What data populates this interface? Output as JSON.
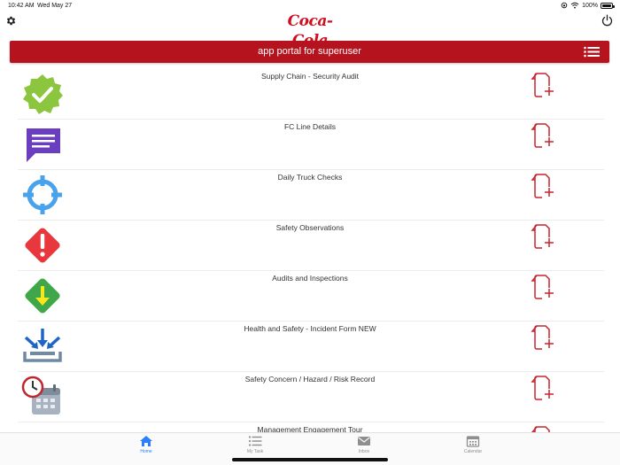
{
  "status_bar": {
    "time": "10:42 AM",
    "date": "Wed May 27",
    "battery": "100%",
    "battery_level": 1.0
  },
  "header": {
    "brand": "Coca-Cola",
    "title": "app portal for superuser"
  },
  "items": [
    {
      "label": "Supply Chain - Security Audit",
      "icon": "verified-badge-icon"
    },
    {
      "label": "FC Line Details",
      "icon": "message-icon"
    },
    {
      "label": "Daily Truck Checks",
      "icon": "crosshair-icon"
    },
    {
      "label": "Safety Observations",
      "icon": "warning-icon"
    },
    {
      "label": "Audits and Inspections",
      "icon": "download-arrow-icon"
    },
    {
      "label": "Health and Safety - Incident Form NEW",
      "icon": "inbox-arrows-icon"
    },
    {
      "label": "Safety Concern / Hazard / Risk Record",
      "icon": "clock-calendar-icon"
    },
    {
      "label": "Management Engagement Tour",
      "icon": "tour-icon"
    }
  ],
  "bottom_nav": [
    {
      "label": "Home",
      "icon": "home-icon",
      "active": true
    },
    {
      "label": "My Task",
      "icon": "list-icon",
      "active": false
    },
    {
      "label": "Inbox",
      "icon": "mail-icon",
      "active": false
    },
    {
      "label": "Calendar",
      "icon": "calendar-icon",
      "active": false
    }
  ],
  "colors": {
    "brand_red": "#b5141f",
    "active_blue": "#2d7ff9",
    "add_icon_red": "#c8232c"
  }
}
